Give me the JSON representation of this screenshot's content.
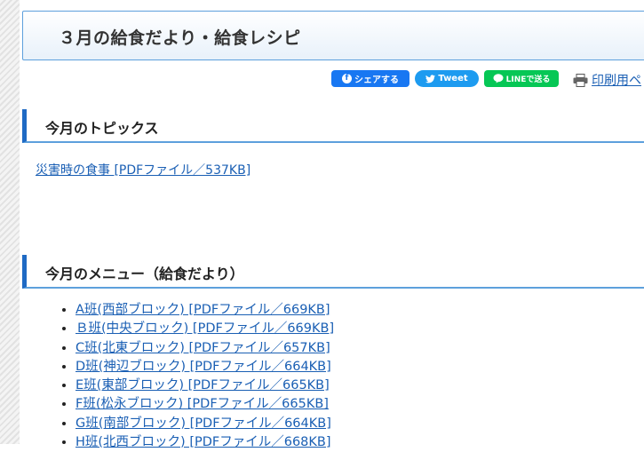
{
  "page": {
    "title": "３月の給食だより・給食レシピ"
  },
  "share": {
    "facebook_label": "シェアする",
    "twitter_label": "Tweet",
    "line_label": "LINEで送る",
    "print_label": "印刷用ペ"
  },
  "topics": {
    "heading": "今月のトピックス",
    "items": [
      {
        "label": "災害時の食事 [PDFファイル／537KB]"
      }
    ]
  },
  "menu": {
    "heading": "今月のメニュー（給食だより）",
    "items": [
      {
        "label": "A班(西部ブロック) [PDFファイル／669KB]"
      },
      {
        "label": "Ｂ班(中央ブロック) [PDFファイル／669KB]"
      },
      {
        "label": "C班(北東ブロック) [PDFファイル／657KB]"
      },
      {
        "label": "D班(神辺ブロック) [PDFファイル／664KB]"
      },
      {
        "label": "E班(東部ブロック) [PDFファイル／665KB]"
      },
      {
        "label": "F班(松永ブロック) [PDFファイル／665KB]"
      },
      {
        "label": "G班(南部ブロック) [PDFファイル／664KB]"
      },
      {
        "label": "H班(北西ブロック) [PDFファイル／668KB]"
      }
    ]
  },
  "colors": {
    "accent": "#1f6ac4",
    "link": "#1a5fb4",
    "facebook": "#1877f2",
    "twitter": "#1d9bf0",
    "line": "#06c755"
  }
}
